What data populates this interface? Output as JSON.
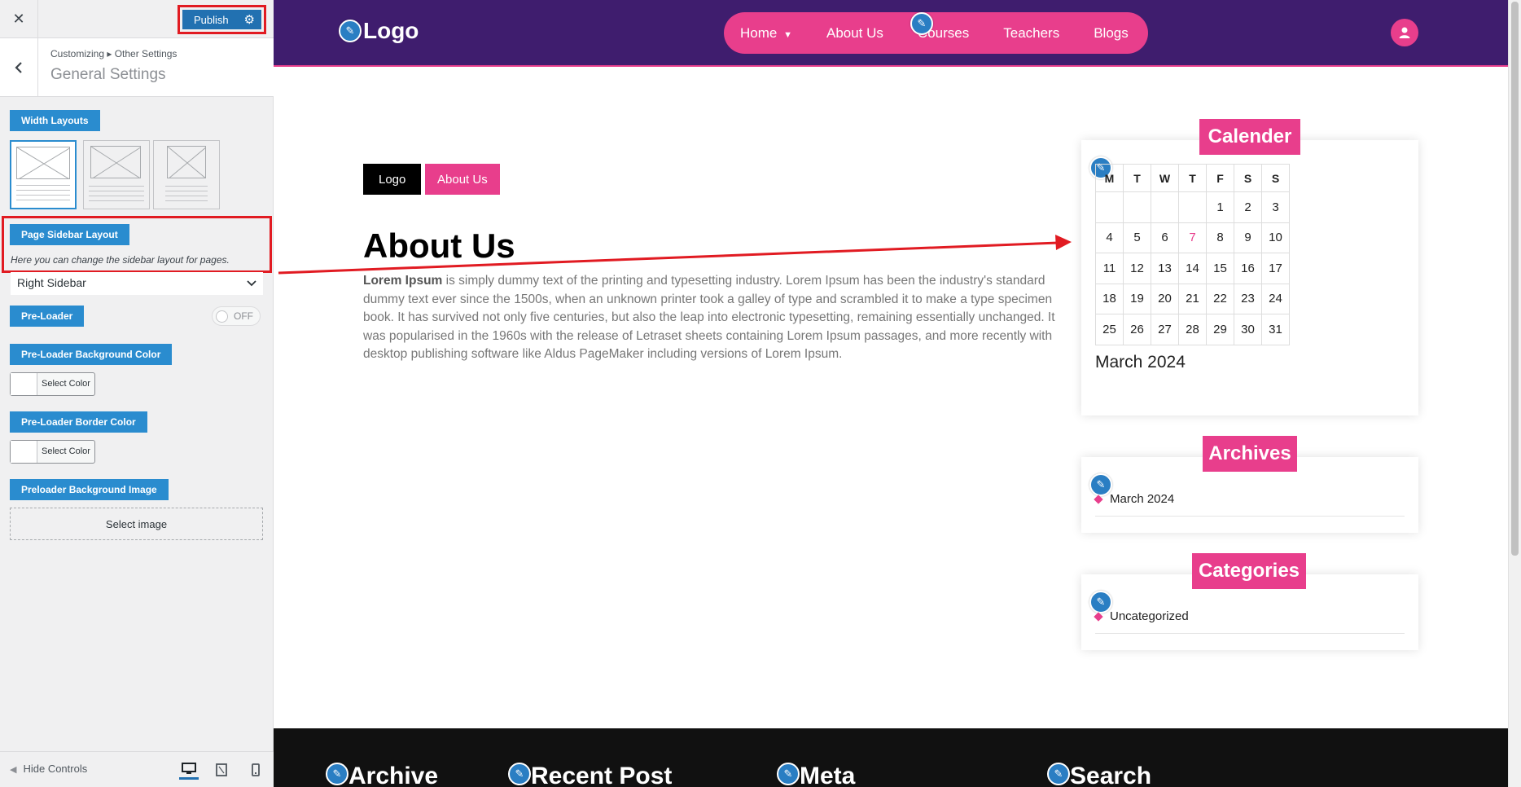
{
  "customizer": {
    "publish_label": "Publish",
    "breadcrumb": "Customizing ▸ Other Settings",
    "section_title": "General Settings",
    "width_layouts_label": "Width Layouts",
    "page_sidebar_layout_label": "Page Sidebar Layout",
    "sidebar_desc": "Here you can change the sidebar layout for pages.",
    "sidebar_select_value": "Right Sidebar",
    "preloader_label": "Pre-Loader",
    "preloader_toggle": "OFF",
    "preloader_bg_color_label": "Pre-Loader Background Color",
    "preloader_border_color_label": "Pre-Loader Border Color",
    "select_color": "Select Color",
    "preloader_bg_image_label": "Preloader Background Image",
    "select_image": "Select image",
    "hide_controls": "Hide Controls"
  },
  "site": {
    "logo": "Logo",
    "nav": [
      "Home",
      "About Us",
      "Courses",
      "Teachers",
      "Blogs"
    ],
    "crumb_logo": "Logo",
    "crumb_about": "About Us",
    "page_title": "About Us",
    "body_lead": "Lorem Ipsum",
    "body_text": " is simply dummy text of the printing and typesetting industry. Lorem Ipsum has been the industry's standard dummy text ever since the 1500s, when an unknown printer took a galley of type and scrambled it to make a type specimen book. It has survived not only five centuries, but also the leap into electronic typesetting, remaining essentially unchanged. It was popularised in the 1960s with the release of Letraset sheets containing Lorem Ipsum passages, and more recently with desktop publishing software like Aldus PageMaker including versions of Lorem Ipsum."
  },
  "calendar": {
    "title": "Calender",
    "days": [
      "M",
      "T",
      "W",
      "T",
      "F",
      "S",
      "S"
    ],
    "weeks": [
      [
        "",
        "",
        "",
        "",
        "1",
        "2",
        "3"
      ],
      [
        "4",
        "5",
        "6",
        "7",
        "8",
        "9",
        "10"
      ],
      [
        "11",
        "12",
        "13",
        "14",
        "15",
        "16",
        "17"
      ],
      [
        "18",
        "19",
        "20",
        "21",
        "22",
        "23",
        "24"
      ],
      [
        "25",
        "26",
        "27",
        "28",
        "29",
        "30",
        "31"
      ]
    ],
    "today": "7",
    "caption": "March 2024"
  },
  "archives": {
    "title": "Archives",
    "items": [
      "March 2024"
    ]
  },
  "categories": {
    "title": "Categories",
    "items": [
      "Uncategorized"
    ]
  },
  "footer": {
    "titles": [
      "Archive",
      "Recent Post",
      "Meta",
      "Search"
    ]
  },
  "colors": {
    "header_bg": "#3f1d6e",
    "accent": "#e83e8c",
    "wp_blue": "#2271b1",
    "annotation_red": "#e11b22"
  }
}
